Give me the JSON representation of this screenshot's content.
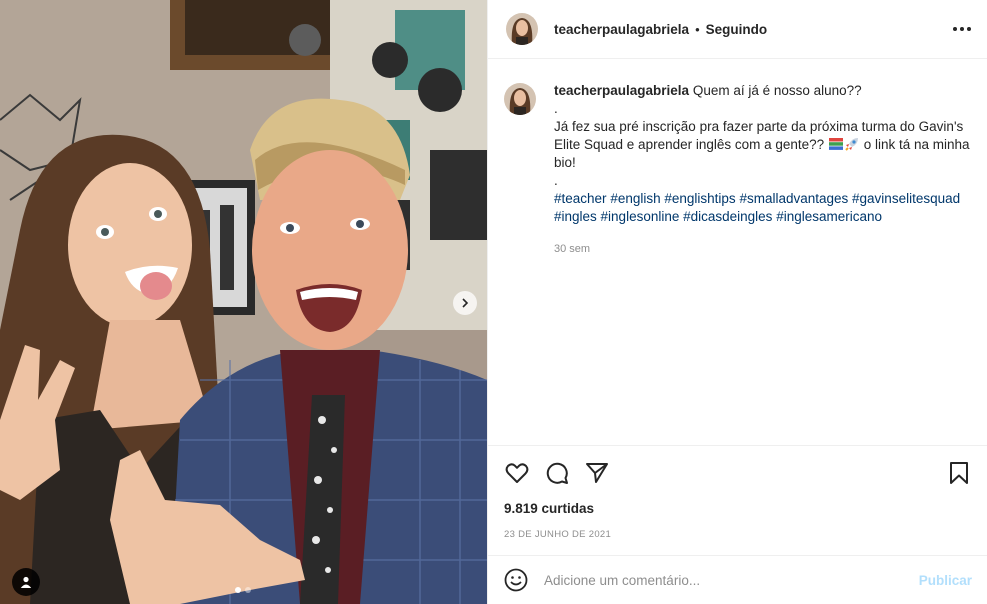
{
  "post": {
    "username": "teacherpaulagabriela",
    "separator": "•",
    "follow_status": "Seguindo",
    "more_icon": "more-horizontal-icon"
  },
  "caption": {
    "username": "teacherpaulagabriela",
    "line1": "Quem aí já é nosso aluno??",
    "dot1": ".",
    "body_part1": "Já fez sua pré inscrição pra fazer parte da próxima turma do Gavin's Elite Squad e aprender inglês com a gente??",
    "emojis": [
      "books-emoji",
      "rocket-emoji"
    ],
    "body_part2": "o link tá na minha bio!",
    "dot2": ".",
    "hashtags": [
      "#teacher",
      "#english",
      "#englishtips",
      "#smalladvantages",
      "#gavinselitesquad",
      "#ingles",
      "#inglesonline",
      "#dicasdeingles",
      "#inglesamericano"
    ],
    "time": "30 sem"
  },
  "actions": {
    "like_icon": "heart-icon",
    "comment_icon": "comment-icon",
    "share_icon": "share-icon",
    "save_icon": "bookmark-icon",
    "likes": "9.819 curtidas",
    "date": "23 DE JUNHO DE 2021"
  },
  "comment_box": {
    "emoji_icon": "smiley-icon",
    "placeholder": "Adicione um comentário...",
    "publish_label": "Publicar"
  },
  "media": {
    "carousel_count": 2,
    "carousel_active": 1,
    "next_icon": "chevron-right-icon",
    "tag_icon": "user-tag-icon"
  },
  "colors": {
    "text": "#262626",
    "secondary": "#8e8e8e",
    "hashtag": "#00376b",
    "publish_disabled": "#b2dffc",
    "divider": "#efefef"
  }
}
